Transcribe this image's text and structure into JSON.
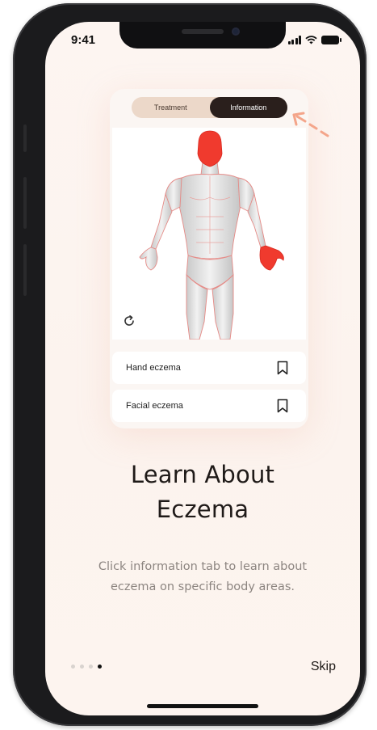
{
  "status_bar": {
    "time": "9:41"
  },
  "card": {
    "tabs": [
      {
        "label": "Treatment",
        "active": false
      },
      {
        "label": "Information",
        "active": true
      }
    ],
    "highlighted_regions": [
      "face",
      "left-hand"
    ],
    "highlight_color": "#f03a2e",
    "conditions": [
      {
        "label": "Hand eczema"
      },
      {
        "label": "Facial eczema"
      }
    ]
  },
  "onboarding": {
    "title_line1": "Learn About",
    "title_line2": "Eczema",
    "description_line1": "Click information tab to learn about",
    "description_line2": "eczema on specific body areas.",
    "page_index": 4,
    "page_count": 4,
    "skip_label": "Skip"
  },
  "colors": {
    "accent": "#2a1f1c",
    "tab_track": "#ecd8c9",
    "background": "#fcf3ee",
    "arrow": "#f4a58a"
  }
}
